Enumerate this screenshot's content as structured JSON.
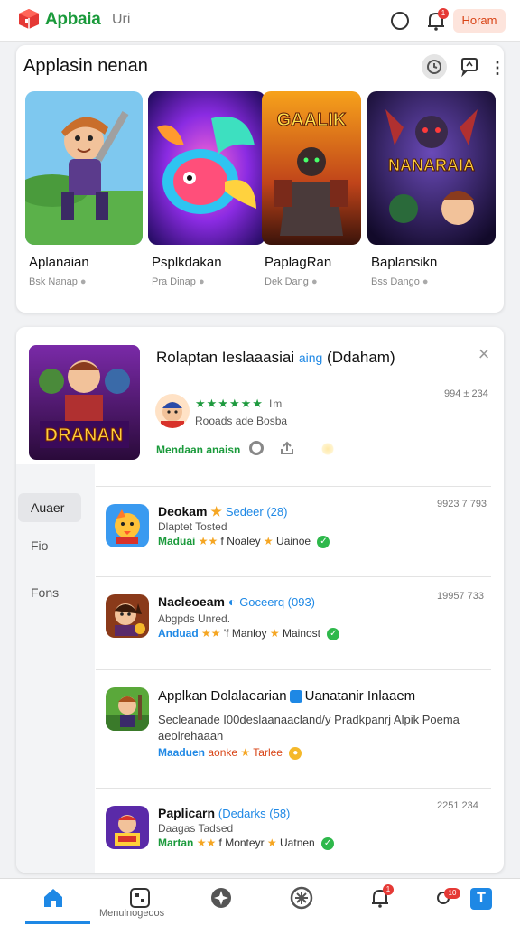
{
  "header": {
    "brand": "Apbaia",
    "brand_sub": "Uri",
    "notif_count": "1",
    "pill_label": "Horam"
  },
  "featured_section": {
    "title": "Applasin nenan",
    "tiles": [
      {
        "name": "Aplanaian",
        "sub": "Bsk Nanap",
        "icon": "game-hero-icon"
      },
      {
        "name": "Psplkdakan",
        "sub": "Pra Dinap",
        "icon": "game-fish-icon"
      },
      {
        "name": "PaplagRan",
        "sub": "Dek Dang",
        "icon": "game-warrior-icon"
      },
      {
        "name": "Baplansikn",
        "sub": "Bss Dango",
        "icon": "game-monster-icon"
      }
    ],
    "tile_cover_texts": [
      "GAALIK",
      "NANARAIA"
    ]
  },
  "detail": {
    "title": "Rolaptan Ieslaaasiai",
    "tag": "aing",
    "title_suffix": "(Ddaham)",
    "stars": "★★★★★★",
    "stars_extra": "Im",
    "stats": "Rooads ade Bosba",
    "date": "994 ± 234",
    "action": "Mendaan anaisn",
    "cover_text": "DRANAN"
  },
  "side_menu": {
    "items": [
      "Auaer",
      "Fio",
      "Fons"
    ]
  },
  "list": [
    {
      "title": "Deokam",
      "tag": "Sedeer (28)",
      "sub": "Dlaptet Tosted",
      "meta_label": "Maduai",
      "meta_stars": "★★",
      "meta_text": "f Noaley",
      "meta_star2": "★",
      "meta_end": "Uainoe",
      "date": "9923 7 793",
      "icon": "game-chick-icon"
    },
    {
      "title": "Nacleoeam",
      "tag": "Goceerq (093)",
      "sub": "Abgpds Unred.",
      "meta_label": "Anduad",
      "meta_stars": "★★",
      "meta_text": "'f Manloy",
      "meta_star2": "★",
      "meta_end": "Mainost",
      "date": "19957 733",
      "icon": "game-knight-icon"
    },
    {
      "title": "Applkan Dolalaearian",
      "tag": "Uanatanir Inlaaem",
      "desc": "Secleanade I00deslaanaacland/y Pradkpanrj Alpik Poema aeolrehaaan",
      "meta_label": "Maaduen",
      "meta_text": "aonke",
      "meta_star": "★",
      "meta_end": "Tarlee",
      "icon": "game-ranger-icon"
    },
    {
      "title": "Paplicarn",
      "tag": "(Dedarks (58)",
      "sub": "Daagas Tadsed",
      "meta_label": "Martan",
      "meta_stars": "★★",
      "meta_text": "f Monteyr",
      "meta_star2": "★",
      "meta_end": "Uatnen",
      "date": "2251 234",
      "icon": "game-arena-icon"
    }
  ],
  "bottom_nav": {
    "label": "Menulnogeoos",
    "badge1": "1",
    "badge2": "10",
    "active_color": "#1e88e5"
  }
}
